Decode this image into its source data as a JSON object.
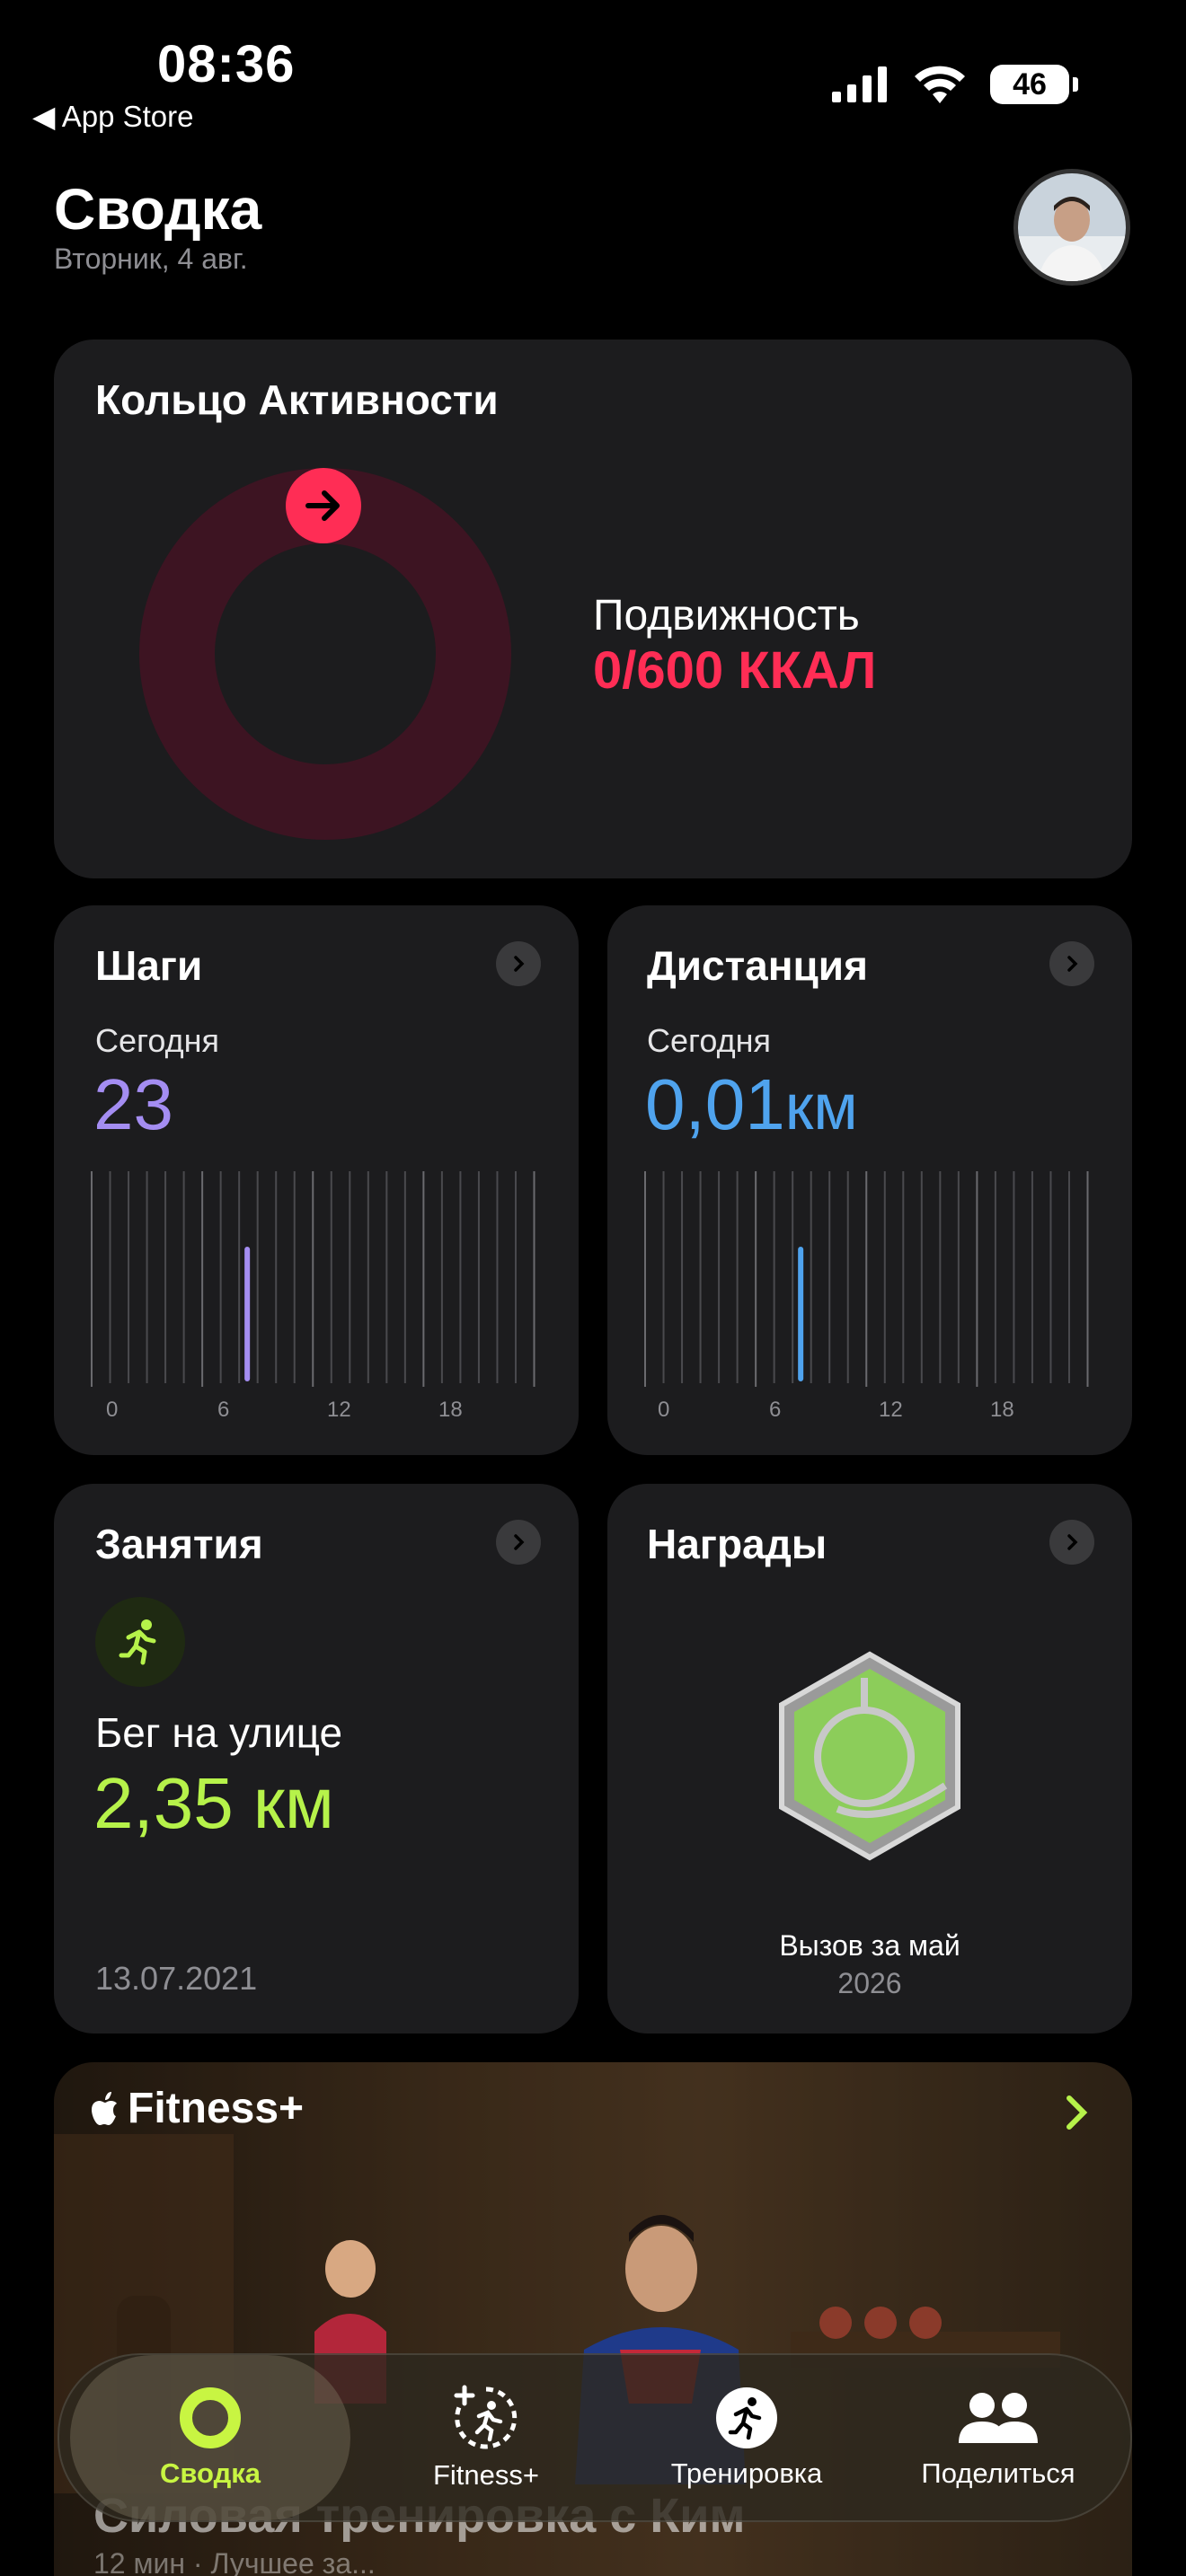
{
  "status": {
    "time": "08:36",
    "back_label": "◀ App Store",
    "battery": "46"
  },
  "header": {
    "title": "Сводка",
    "date": "Вторник, 4 авг."
  },
  "activity": {
    "title": "Кольцо Активности",
    "move_label": "Подвижность",
    "move_value": "0/600 ККАЛ",
    "ring_color": "#ff2d55",
    "progress": 0
  },
  "steps": {
    "title": "Шаги",
    "period": "Сегодня",
    "value": "23",
    "color": "#a48df2",
    "axis": [
      "0",
      "6",
      "12",
      "18"
    ]
  },
  "distance": {
    "title": "Дистанция",
    "period": "Сегодня",
    "value": "0,01",
    "unit": "км",
    "color": "#4fa3ee",
    "axis": [
      "0",
      "6",
      "12",
      "18"
    ]
  },
  "workouts": {
    "title": "Занятия",
    "name": "Бег на улице",
    "value": "2,35 км",
    "date": "13.07.2021",
    "color": "#b6f24a"
  },
  "awards": {
    "title": "Награды",
    "caption": "Вызов за май",
    "year": "2026"
  },
  "fitness": {
    "title": "Fitness+",
    "workout": "Силовая тренировка с Ким",
    "meta": "12 мин · Лучшее за..."
  },
  "tabs": [
    {
      "label": "Сводка",
      "icon": "ring-icon",
      "active": true
    },
    {
      "label": "Fitness+",
      "icon": "fitness-plus-icon",
      "active": false
    },
    {
      "label": "Тренировка",
      "icon": "running-icon",
      "active": false
    },
    {
      "label": "Поделиться",
      "icon": "people-icon",
      "active": false
    }
  ]
}
